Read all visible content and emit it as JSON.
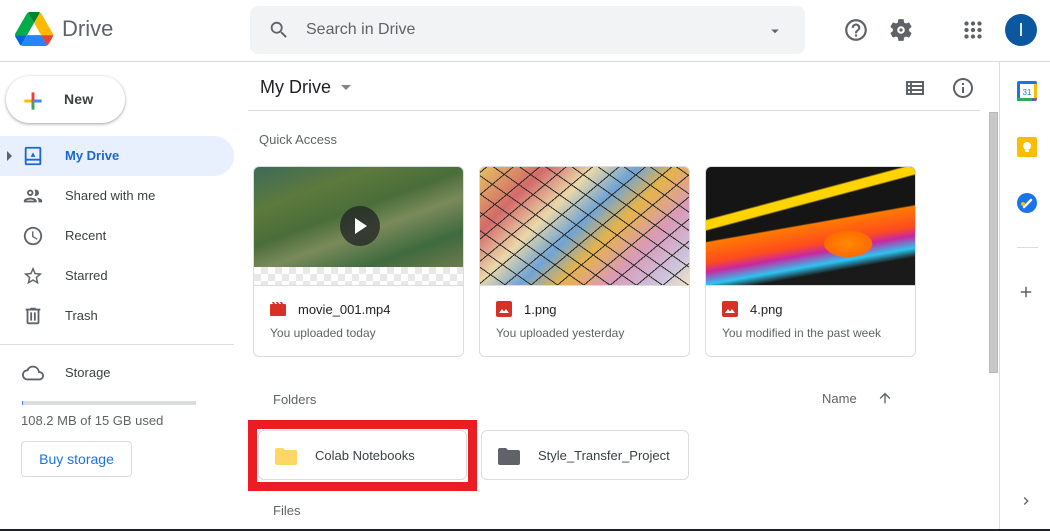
{
  "header": {
    "app_title": "Drive",
    "search": {
      "placeholder": "Search in Drive",
      "value": ""
    },
    "avatar_initial": "I",
    "icons": [
      "drive-logo-icon",
      "search-icon",
      "search-options-icon",
      "help-icon",
      "settings-icon",
      "apps-grid-icon"
    ]
  },
  "sidebar": {
    "new_label": "New",
    "items": [
      {
        "label": "My Drive",
        "icon": "my-drive-icon",
        "active": true
      },
      {
        "label": "Shared with me",
        "icon": "shared-icon",
        "active": false
      },
      {
        "label": "Recent",
        "icon": "clock-icon",
        "active": false
      },
      {
        "label": "Starred",
        "icon": "star-icon",
        "active": false
      },
      {
        "label": "Trash",
        "icon": "trash-icon",
        "active": false
      }
    ],
    "storage": {
      "label": "Storage",
      "used_text": "108.2 MB of 15 GB used",
      "used_fraction": 0.007,
      "buy_label": "Buy storage"
    }
  },
  "main": {
    "title": "My Drive",
    "quick_access_label": "Quick Access",
    "quick_access": [
      {
        "name": "movie_001.mp4",
        "meta": "You uploaded today",
        "type": "video"
      },
      {
        "name": "1.png",
        "meta": "You uploaded yesterday",
        "type": "image"
      },
      {
        "name": "4.png",
        "meta": "You modified in the past week",
        "type": "image"
      }
    ],
    "folders_label": "Folders",
    "sort_label": "Name",
    "folders": [
      {
        "name": "Colab Notebooks",
        "color": "#fdd663",
        "highlighted": true
      },
      {
        "name": "Style_Transfer_Project",
        "color": "#5f6368",
        "highlighted": false
      }
    ],
    "files_label": "Files"
  },
  "colors": {
    "accent": "#1a73e8",
    "active_bg": "#e8f0fe",
    "highlight": "#ec1c24",
    "avatar": "#0b57a0"
  }
}
